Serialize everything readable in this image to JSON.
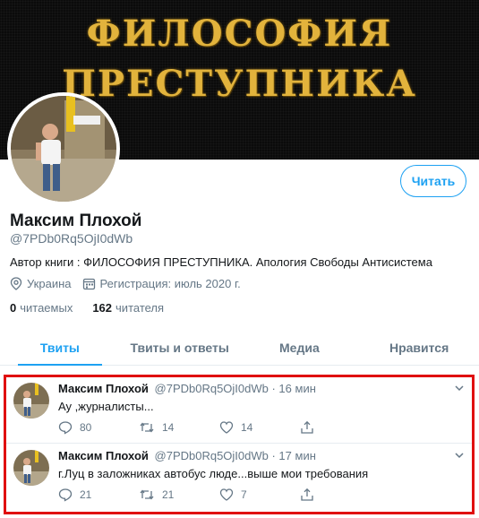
{
  "banner": {
    "line1": "ФИЛОСОФИЯ",
    "line2": "ПРЕСТУПНИКА"
  },
  "profile": {
    "follow_label": "Читать",
    "name": "Максим Плохой",
    "handle": "@7PDb0Rq5OjI0dWb",
    "bio": "Автор книги : ФИЛОСОФИЯ ПРЕСТУПНИКА. Апология Свободы Антисистема",
    "location": "Украина",
    "joined": "Регистрация: июль 2020 г.",
    "following_count": "0",
    "following_label": "читаемых",
    "followers_count": "162",
    "followers_label": "читателя"
  },
  "tabs": [
    "Твиты",
    "Твиты и ответы",
    "Медиа",
    "Нравится"
  ],
  "tweets": [
    {
      "name": "Максим Плохой",
      "handle_time": "@7PDb0Rq5OjI0dWb · 16 мин",
      "text": "Ау ,журналисты...",
      "replies": "80",
      "retweets": "14",
      "likes": "14"
    },
    {
      "name": "Максим Плохой",
      "handle_time": "@7PDb0Rq5OjI0dWb · 17 мин",
      "text": "г.Луц в заложниках автобус люде...выше мои требования",
      "replies": "21",
      "retweets": "21",
      "likes": "7"
    }
  ],
  "colors": {
    "accent": "#1da1f2",
    "highlight_border": "#e01010",
    "banner_text": "#e2b33c"
  },
  "icons": [
    "location-pin-icon",
    "calendar-icon",
    "reply-icon",
    "retweet-icon",
    "like-icon",
    "share-icon",
    "chevron-down-icon"
  ]
}
